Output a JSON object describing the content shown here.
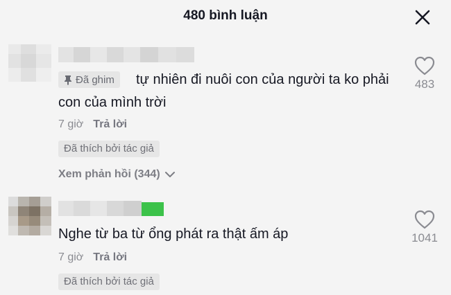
{
  "header": {
    "title": "480 bình luận",
    "close_icon": "close-icon"
  },
  "comments": [
    {
      "pinned_label": "Đã ghim",
      "text": "tự nhiên đi nuôi con của người ta ko phải con của mình trời",
      "time": "7 giờ",
      "reply_label": "Trả lời",
      "liked_by_author": "Đã thích bởi tác giả",
      "view_replies": "Xem phản hồi (344)",
      "likes": "483"
    },
    {
      "text": "Nghe từ ba từ ổng phát ra thật ấm áp",
      "time": "7 giờ",
      "reply_label": "Trả lời",
      "liked_by_author": "Đã thích bởi tác giả",
      "likes": "1041"
    }
  ],
  "colors": {
    "background": "#f4f4f4",
    "text_primary": "#161823",
    "text_secondary": "#8a8b91",
    "badge_bg": "#e6e6e6"
  }
}
